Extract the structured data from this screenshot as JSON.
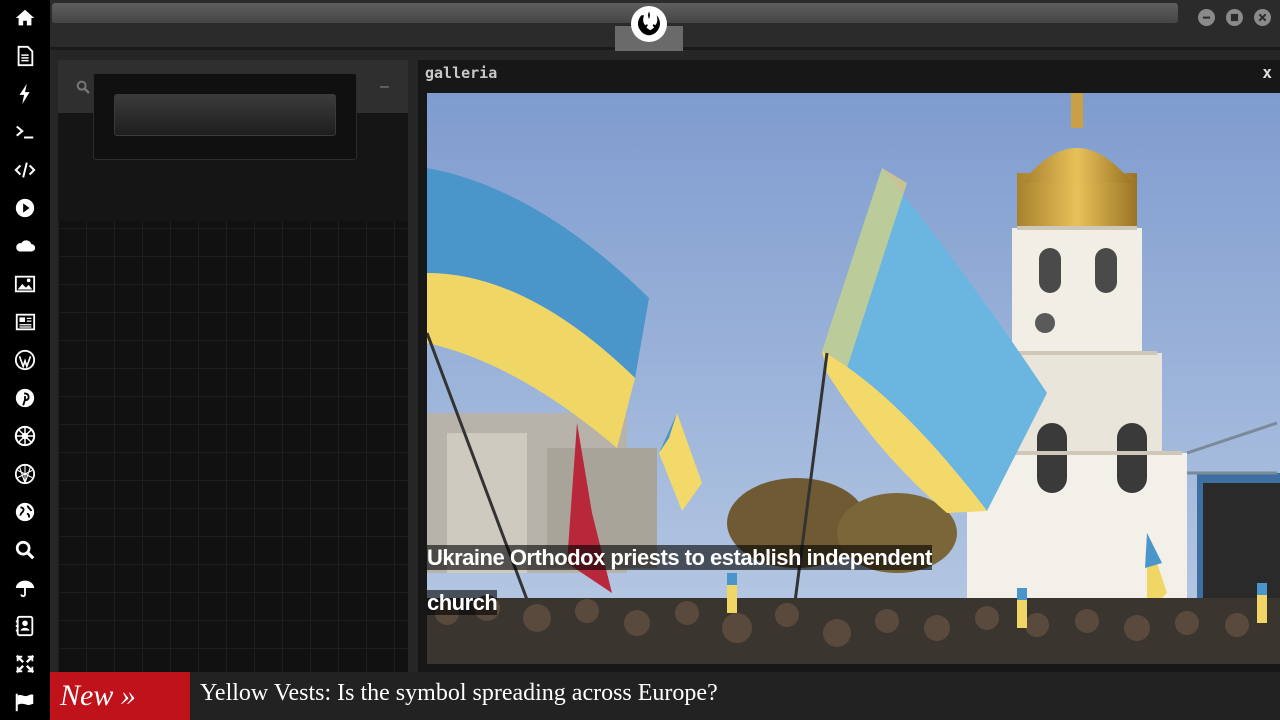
{
  "dock": {
    "items": [
      {
        "name": "home-icon"
      },
      {
        "name": "document-icon"
      },
      {
        "name": "bolt-icon"
      },
      {
        "name": "terminal-icon"
      },
      {
        "name": "code-icon"
      },
      {
        "name": "play-icon"
      },
      {
        "name": "cloud-icon"
      },
      {
        "name": "image-icon"
      },
      {
        "name": "newspaper-icon"
      },
      {
        "name": "wordpress-icon"
      },
      {
        "name": "pinterest-icon"
      },
      {
        "name": "empire-icon"
      },
      {
        "name": "network-globe-icon"
      },
      {
        "name": "globe-icon"
      },
      {
        "name": "search-icon"
      },
      {
        "name": "umbrella-icon"
      },
      {
        "name": "contact-book-icon"
      },
      {
        "name": "expand-arrows-icon"
      },
      {
        "name": "flag-icon"
      }
    ]
  },
  "header": {
    "logo": "rebel-alliance-logo-icon",
    "window_controls": [
      "minimize",
      "maximize",
      "close"
    ]
  },
  "left_panel": {
    "minimize_label": "–"
  },
  "gallery": {
    "title": "galleria",
    "close_label": "x",
    "caption": "Ukraine Orthodox priests to establish independent church"
  },
  "ticker": {
    "badge": "New »",
    "headline": "Yellow Vests: Is the symbol spreading across Europe?"
  },
  "colors": {
    "ticker_badge": "#c0121b",
    "flag_blue": "#4a95c9",
    "flag_yellow": "#f0d765"
  }
}
